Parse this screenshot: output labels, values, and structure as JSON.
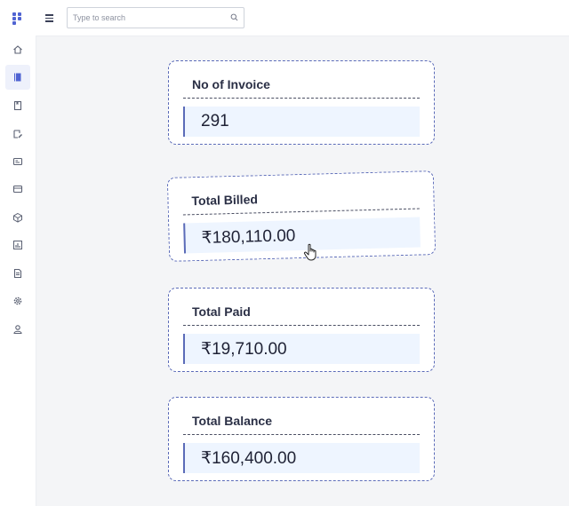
{
  "search": {
    "placeholder": "Type to search"
  },
  "sidebar": {
    "items": [
      {
        "icon": "home-icon"
      },
      {
        "icon": "book-icon",
        "active": true
      },
      {
        "icon": "bookmark-icon"
      },
      {
        "icon": "edit-doc-icon"
      },
      {
        "icon": "id-card-icon"
      },
      {
        "icon": "card-icon"
      },
      {
        "icon": "box-icon"
      },
      {
        "icon": "chart-icon"
      },
      {
        "icon": "document-icon"
      },
      {
        "icon": "gear-icon"
      },
      {
        "icon": "user-icon"
      }
    ]
  },
  "cards": [
    {
      "title": "No of Invoice",
      "value": "291"
    },
    {
      "title": "Total Billed",
      "value": "₹180,110.00"
    },
    {
      "title": "Total Paid",
      "value": "₹19,710.00"
    },
    {
      "title": "Total Balance",
      "value": "₹160,400.00"
    }
  ],
  "colors": {
    "accent": "#5b6bb8",
    "brand": "#4f63d2",
    "value_bg": "#eef5ff"
  }
}
